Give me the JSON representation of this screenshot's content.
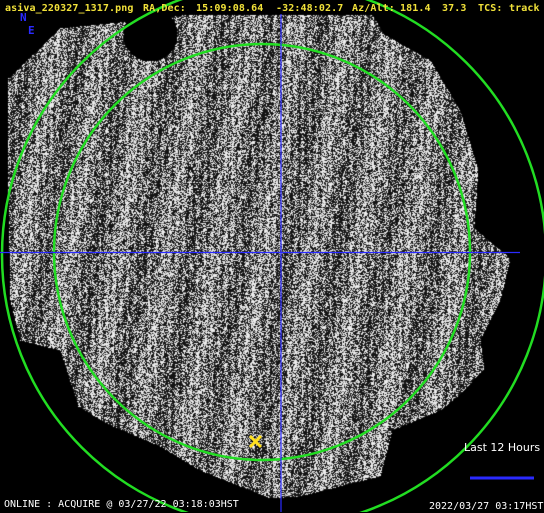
{
  "header": {
    "filename": "asiva_220327_1317.png",
    "radec_label": "RA,Dec:",
    "ra": "15:09:08.64",
    "dec": "-32:48:02.7",
    "azalt_label": "Az/Alt:",
    "az": "181.4",
    "alt": "37.3",
    "tcs_label": "TCS:",
    "tcs_status": "track"
  },
  "compass": {
    "north": "N",
    "east": "E"
  },
  "legend": {
    "label": "Last 12 Hours"
  },
  "footer": {
    "status": "ONLINE : ACQUIRE @ 03/27/22 03:18:03HST",
    "timestamp": "2022/03/27 03:17HST"
  },
  "colors": {
    "background": "#000000",
    "header_text": "#f2e23a",
    "crosshair": "#2a2aff",
    "circle": "#22dd22",
    "target_marker": "#ffe020",
    "legend_line": "#2a2aff",
    "footer_text": "#ffffff"
  },
  "icons": {
    "target": "x-mark-icon"
  }
}
